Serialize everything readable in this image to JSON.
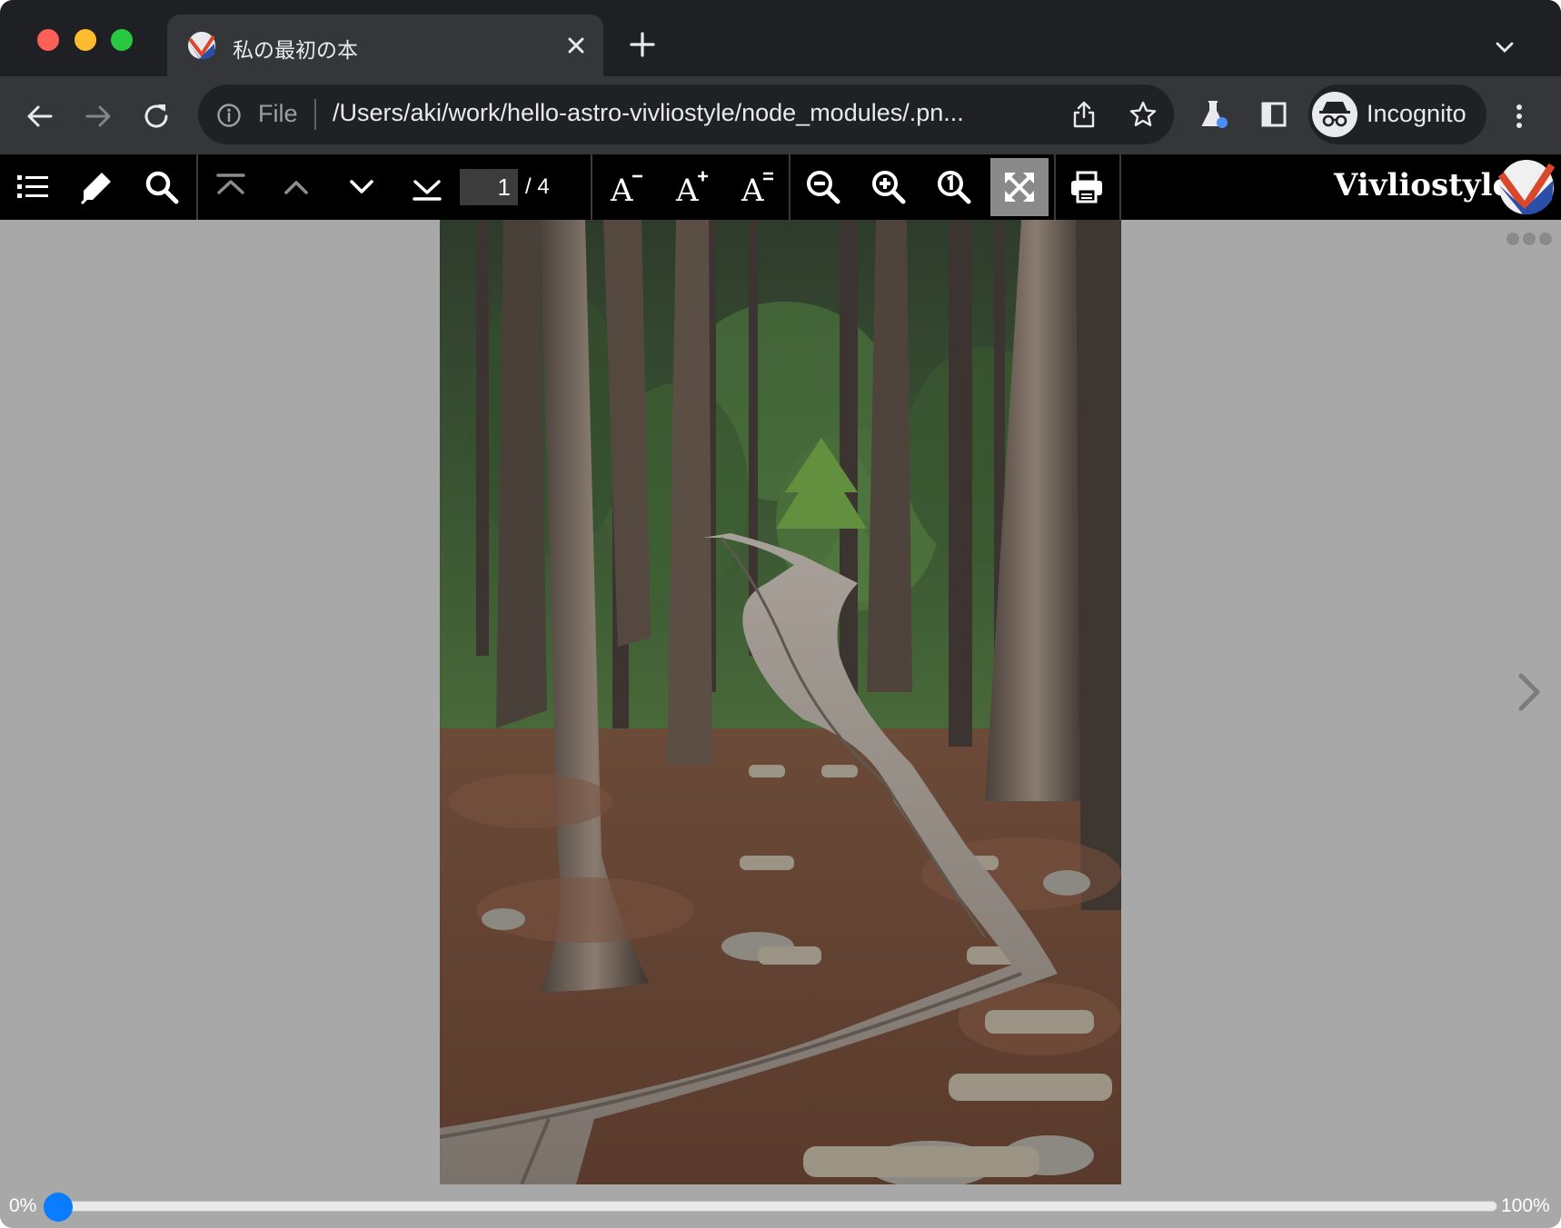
{
  "window": {
    "traffic_lights": [
      "close",
      "minimize",
      "maximize"
    ]
  },
  "tab": {
    "title": "私の最初の本",
    "favicon": "vivliostyle-logo-icon",
    "close_icon": "close-icon"
  },
  "tabstrip": {
    "new_tab_icon": "plus-icon",
    "tab_search_icon": "chevron-down-icon"
  },
  "toolbar": {
    "back_icon": "arrow-left-icon",
    "forward_icon": "arrow-right-icon",
    "reload_icon": "reload-icon",
    "omnibox": {
      "scheme_label": "File",
      "url": "/Users/aki/work/hello-astro-vivliostyle/node_modules/.pn...",
      "share_icon": "share-icon",
      "bookmark_icon": "star-icon"
    },
    "extension_icon": "flask-icon",
    "side_panel_icon": "side-panel-icon",
    "profile_label": "Incognito",
    "menu_icon": "more-vert-icon"
  },
  "viewer": {
    "tools": [
      "toc-icon",
      "marker-icon",
      "search-icon",
      "first-page-icon",
      "previous-page-icon",
      "next-page-icon",
      "last-page-icon",
      "font-size-decrease-icon",
      "font-size-increase-icon",
      "font-size-reset-icon",
      "zoom-out-icon",
      "zoom-in-icon",
      "zoom-actual-icon",
      "fit-to-screen-icon",
      "print-icon"
    ],
    "page_current": "1",
    "page_total": "/ 4",
    "brand": "Vivliostyle",
    "fullscreen_active": true
  },
  "content": {
    "page_image": "forest-boardwalk-photo",
    "more_icon": "more-horiz-icon",
    "next_icon": "chevron-right-icon"
  },
  "progress": {
    "start_label": "0%",
    "end_label": "100%",
    "value": 0.008
  },
  "colors": {
    "tabstrip_bg": "#1f2023",
    "toolbar_bg": "#35363a",
    "viewer_bar_bg": "#000000",
    "content_bg": "#a8a8a8",
    "slider_accent": "#0a7cff"
  }
}
